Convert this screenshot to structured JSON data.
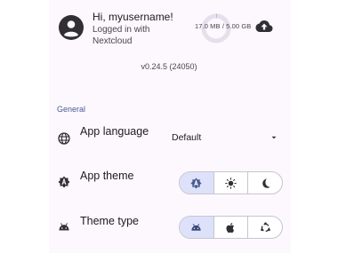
{
  "header": {
    "greeting": "Hi, myusername!",
    "login_line1": "Logged in with",
    "login_line2": "Nextcloud",
    "storage": "17.0 MB / 5.00 GB",
    "storage_used_fraction": 0.0034
  },
  "version": "v0.24.5 (24050)",
  "general": {
    "section_title": "General",
    "app_language": {
      "label": "App language",
      "value": "Default"
    },
    "app_theme": {
      "label": "App theme",
      "options": [
        "auto-theme-icon",
        "light-theme-icon",
        "dark-theme-icon"
      ],
      "selected_index": 0
    },
    "theme_type": {
      "label": "Theme type",
      "options": [
        "android-icon",
        "apple-icon",
        "ubuntu-icon"
      ],
      "selected_index": 0
    }
  },
  "colors": {
    "panel_bg": "#fdf8fd",
    "accent": "#4b5c92",
    "selected_segment": "#dde1f9",
    "ring_track": "#e4e1ec"
  }
}
